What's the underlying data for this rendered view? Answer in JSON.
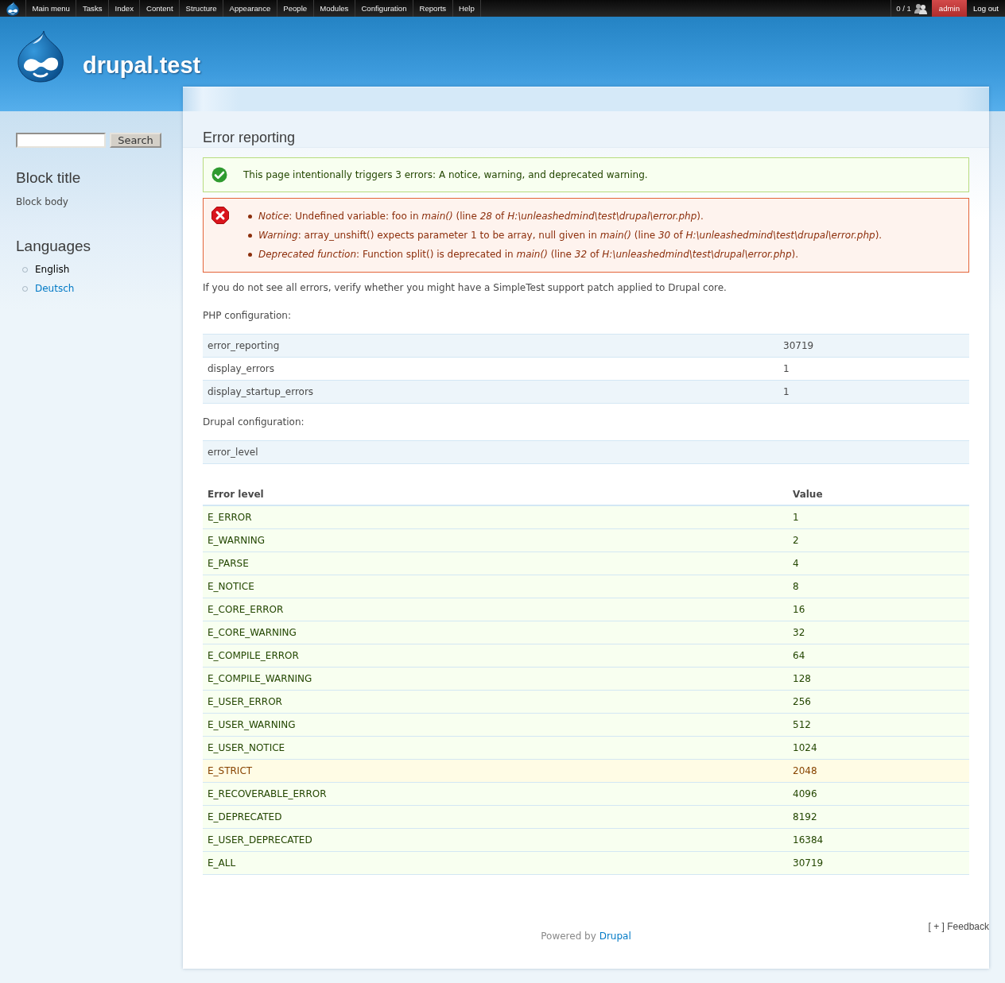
{
  "toolbar": {
    "menu": [
      {
        "label": "Main menu"
      },
      {
        "label": "Tasks"
      },
      {
        "label": "Index"
      },
      {
        "label": "Content"
      },
      {
        "label": "Structure"
      },
      {
        "label": "Appearance"
      },
      {
        "label": "People"
      },
      {
        "label": "Modules"
      },
      {
        "label": "Configuration"
      },
      {
        "label": "Reports"
      },
      {
        "label": "Help"
      }
    ],
    "online": "0 / 1",
    "user": "admin",
    "logout": "Log out"
  },
  "header": {
    "site_name": "drupal.test"
  },
  "sidebar": {
    "search": {
      "button": "Search"
    },
    "block": {
      "title": "Block title",
      "body": "Block body"
    },
    "languages": {
      "title": "Languages",
      "items": [
        {
          "label": "English",
          "selected": true
        },
        {
          "label": "Deutsch",
          "selected": false
        }
      ]
    }
  },
  "page": {
    "title": "Error reporting",
    "messages": [
      {
        "kind": "status",
        "items": [
          "This page intentionally triggers 3 errors: A notice, warning, and deprecated warning."
        ]
      },
      {
        "kind": "error",
        "items": [
          "*Notice*: Undefined variable: foo in *main()* (line *28* of *H:\\unleashedmind\\test\\drupal\\error.php*).",
          "*Warning*: array_unshift() expects parameter 1 to be array, null given in *main()* (line *30* of *H:\\unleashedmind\\test\\drupal\\error.php*).",
          "*Deprecated function*: Function split() is deprecated in *main()* (line *32* of *H:\\unleashedmind\\test\\drupal\\error.php*)."
        ]
      }
    ],
    "note": "If you do not see all errors, verify whether you might have a SimpleTest support patch applied to Drupal core.",
    "php_label": "PHP configuration:",
    "php_table": [
      [
        "error_reporting",
        "30719"
      ],
      [
        "display_errors",
        "1"
      ],
      [
        "display_startup_errors",
        "1"
      ]
    ],
    "drupal_label": "Drupal configuration:",
    "drupal_table": [
      [
        "error_level"
      ]
    ],
    "levels_table": {
      "columns": [
        "Error level",
        "Value"
      ],
      "rows": [
        {
          "cells": [
            "E_ERROR",
            "1"
          ],
          "kind": "ok"
        },
        {
          "cells": [
            "E_WARNING",
            "2"
          ],
          "kind": "ok"
        },
        {
          "cells": [
            "E_PARSE",
            "4"
          ],
          "kind": "ok"
        },
        {
          "cells": [
            "E_NOTICE",
            "8"
          ],
          "kind": "ok"
        },
        {
          "cells": [
            "E_CORE_ERROR",
            "16"
          ],
          "kind": "ok"
        },
        {
          "cells": [
            "E_CORE_WARNING",
            "32"
          ],
          "kind": "ok"
        },
        {
          "cells": [
            "E_COMPILE_ERROR",
            "64"
          ],
          "kind": "ok"
        },
        {
          "cells": [
            "E_COMPILE_WARNING",
            "128"
          ],
          "kind": "ok"
        },
        {
          "cells": [
            "E_USER_ERROR",
            "256"
          ],
          "kind": "ok"
        },
        {
          "cells": [
            "E_USER_WARNING",
            "512"
          ],
          "kind": "ok"
        },
        {
          "cells": [
            "E_USER_NOTICE",
            "1024"
          ],
          "kind": "ok"
        },
        {
          "cells": [
            "E_STRICT",
            "2048"
          ],
          "kind": "warning"
        },
        {
          "cells": [
            "E_RECOVERABLE_ERROR",
            "4096"
          ],
          "kind": "ok"
        },
        {
          "cells": [
            "E_DEPRECATED",
            "8192"
          ],
          "kind": "ok"
        },
        {
          "cells": [
            "E_USER_DEPRECATED",
            "16384"
          ],
          "kind": "ok"
        },
        {
          "cells": [
            "E_ALL",
            "30719"
          ],
          "kind": "ok"
        }
      ]
    }
  },
  "footer": {
    "text": "Powered by",
    "link": "Drupal",
    "feedback": "[ + ] Feedback"
  }
}
